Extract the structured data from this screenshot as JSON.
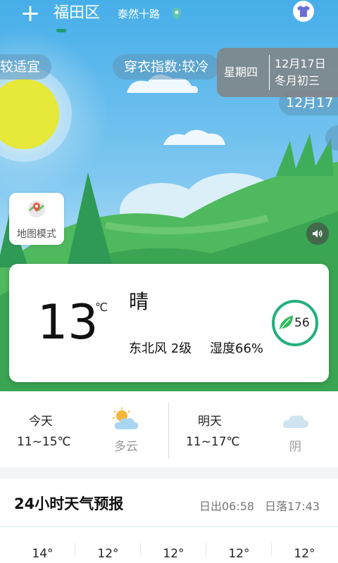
{
  "header": {
    "add_label": "+",
    "city": "福田区",
    "road": "泰然十路"
  },
  "tips": {
    "left": "较适宜",
    "clothes": "穿衣指数:较冷",
    "date_repeat": "12月17"
  },
  "date_box": {
    "weekday": "星期四",
    "date": "12月17日",
    "lunar": "冬月初三"
  },
  "map_mode": {
    "label": "地图模式"
  },
  "current": {
    "temp": "13",
    "unit": "℃",
    "condition": "晴",
    "wind": "东北风 2级",
    "humidity": "湿度66%",
    "aqi": "56"
  },
  "forecast": [
    {
      "day": "今天",
      "range": "11~15℃",
      "desc": "多云",
      "icon": "partly-cloudy-icon"
    },
    {
      "day": "明天",
      "range": "11~17℃",
      "desc": "阴",
      "icon": "cloudy-icon"
    }
  ],
  "hourly": {
    "title": "24小时天气预报",
    "sunrise": "日出06:58",
    "sunset": "日落17:43",
    "temps": [
      "14°",
      "12°",
      "12°",
      "12°",
      "12°"
    ]
  },
  "colors": {
    "accent": "#1b9c74",
    "aqi_ring": "#23b07a",
    "sky": "#46aee9"
  }
}
